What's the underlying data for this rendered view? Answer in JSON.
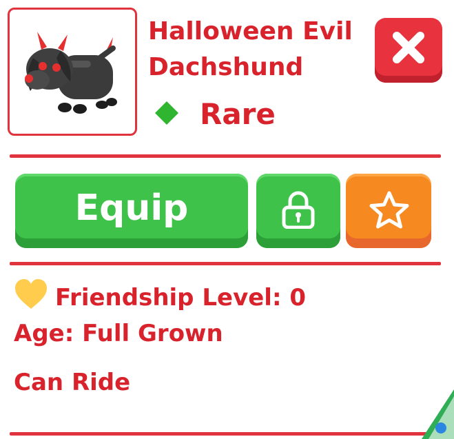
{
  "pet": {
    "name": "Halloween Evil Dachshund",
    "rarity": "Rare",
    "rarity_color": "#2fb52f",
    "image": "halloween-evil-dachshund"
  },
  "buttons": {
    "equip_label": "Equip",
    "close_icon": "close-x-icon",
    "lock_icon": "padlock-icon",
    "favorite_icon": "star-icon"
  },
  "info": {
    "friendship": "Friendship Level: 0",
    "age": "Age: Full Grown",
    "ride": "Can Ride"
  },
  "colors": {
    "accent_red": "#d8232d",
    "button_green": "#3ec24a",
    "button_orange": "#f6891f",
    "heart_yellow": "#ffcc4d"
  }
}
